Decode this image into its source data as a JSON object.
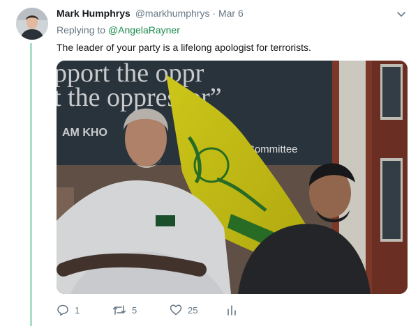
{
  "tweet": {
    "display_name": "Mark Humphrys",
    "handle": "@markhumphrys",
    "separator": "·",
    "time": "Mar 6",
    "replying_to_label": "Replying to",
    "replying_to_handle": "@AngelaRayner",
    "text": "The leader of your party is a lifelong apologist for terrorists."
  },
  "media": {
    "banner_line1": "pport the oppr",
    "banner_line2": "t the oppressor”",
    "banner_line3": "AM KHO",
    "banner_committee": "Committee"
  },
  "actions": {
    "replies": "1",
    "retweets": "5",
    "likes": "25"
  },
  "colors": {
    "link": "#1b95e0",
    "thread_line": "#a8dfc5",
    "muted": "#657786"
  }
}
